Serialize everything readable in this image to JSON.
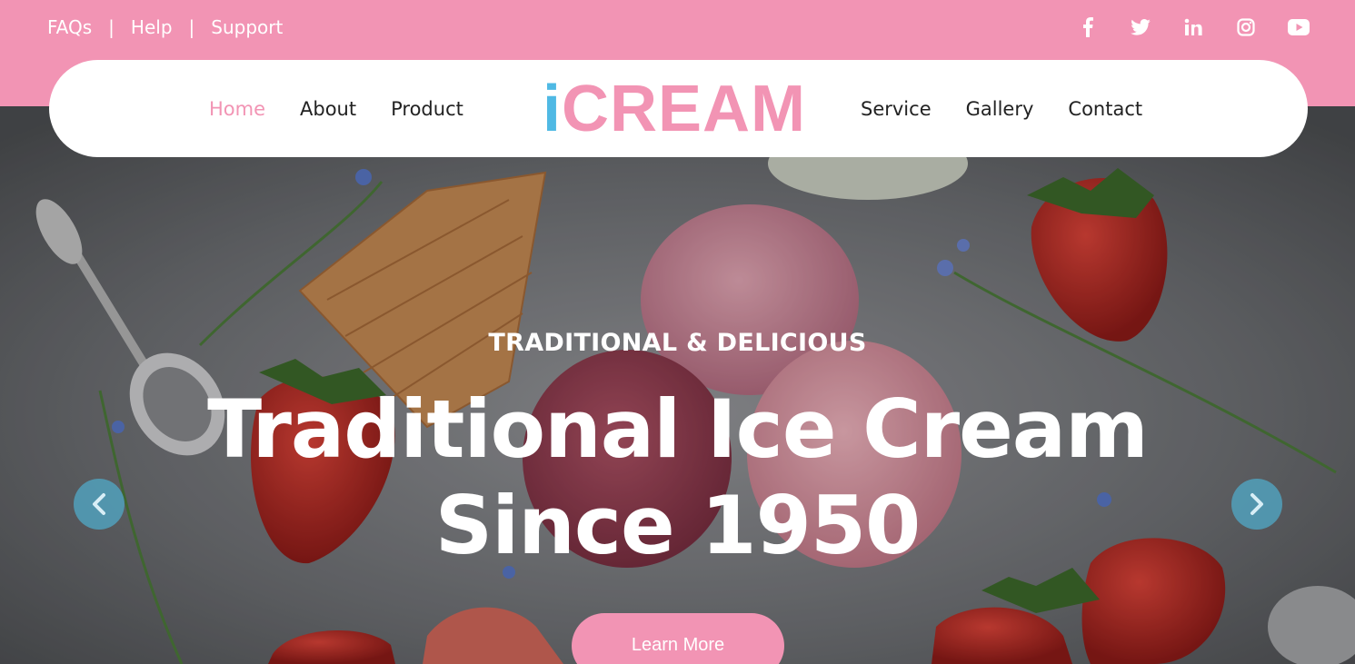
{
  "top_links": [
    "FAQs",
    "Help",
    "Support"
  ],
  "separator": "|",
  "social_icons": [
    "facebook-icon",
    "twitter-icon",
    "linkedin-icon",
    "instagram-icon",
    "youtube-icon"
  ],
  "nav": {
    "left": [
      {
        "label": "Home",
        "active": true
      },
      {
        "label": "About",
        "active": false
      },
      {
        "label": "Product",
        "active": false
      }
    ],
    "right": [
      {
        "label": "Service",
        "active": false
      },
      {
        "label": "Gallery",
        "active": false
      },
      {
        "label": "Contact",
        "active": false
      }
    ]
  },
  "logo": {
    "first": "i",
    "rest": "CREAM"
  },
  "hero": {
    "kicker": "TRADITIONAL & DELICIOUS",
    "headline_line1": "Traditional Ice Cream",
    "headline_line2": "Since 1950",
    "cta": "Learn More"
  },
  "colors": {
    "brand_pink": "#f294b4",
    "brand_blue": "#4fb9e4",
    "arrow": "#50aac8"
  }
}
